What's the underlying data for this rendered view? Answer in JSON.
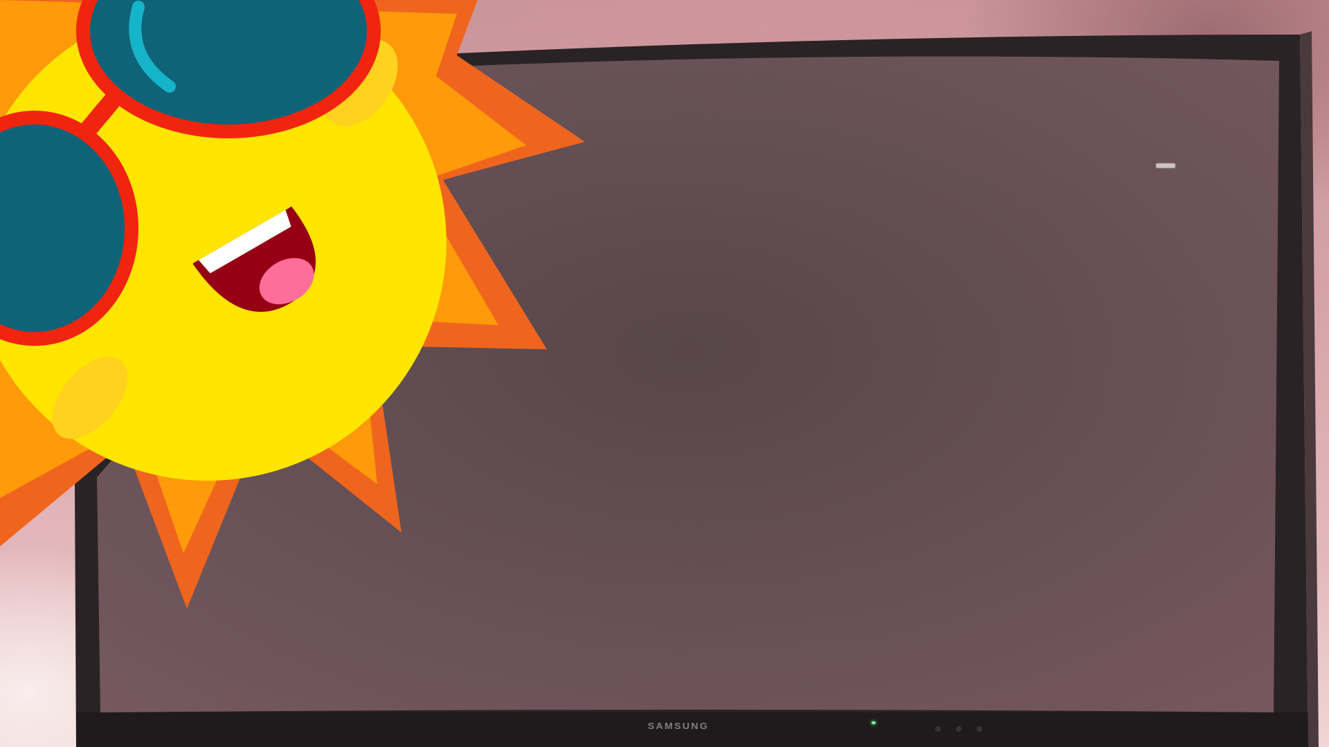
{
  "scene": {
    "description_visible": "",
    "monitor": {
      "brand_text": "SAMSUNG",
      "power_led_color": "#7dffa0",
      "screen_color": "#5a4a4d",
      "bezel_color": "#2a2325"
    },
    "sticker": {
      "type": "sun-with-sunglasses",
      "face_color": "#ffe500",
      "ray_outer_color": "#f0651e",
      "ray_inner_color": "#ff9a0a",
      "glasses_frame_color": "#f0240f",
      "lens_color": "#0f6378",
      "lens_highlight_color": "#16b4c8",
      "mouth_color": "#960014",
      "tongue_color": "#ff6e9b"
    }
  }
}
